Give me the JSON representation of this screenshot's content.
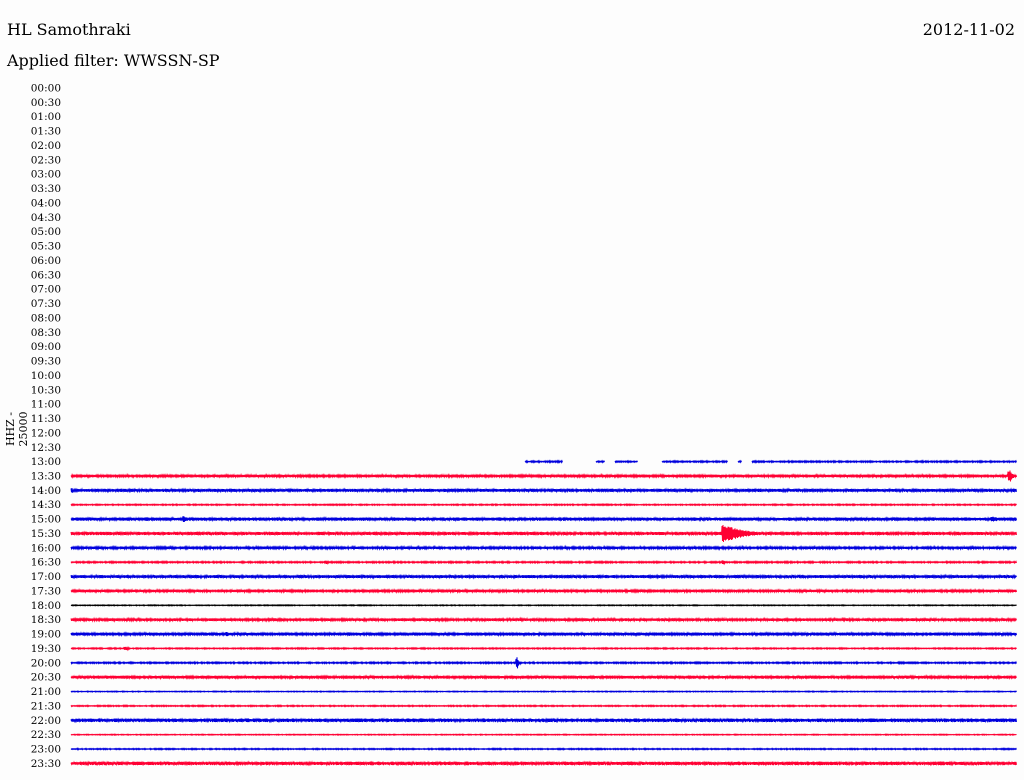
{
  "header": {
    "station": "HL Samothraki",
    "date": "2012-11-02",
    "filter": "Applied filter: WWSSN-SP",
    "channel": "HHZ - 25000"
  },
  "colors": {
    "red": "#ff0033",
    "blue": "#0000dd",
    "black": "#000000"
  },
  "chart_data": {
    "type": "line",
    "title": "HL Samothraki",
    "ylabel": "HHZ - 25000",
    "ytick_labels": [
      "00:00",
      "00:30",
      "01:00",
      "01:30",
      "02:00",
      "02:30",
      "03:00",
      "03:30",
      "04:00",
      "04:30",
      "05:00",
      "05:30",
      "06:00",
      "06:30",
      "07:00",
      "07:30",
      "08:00",
      "08:30",
      "09:00",
      "09:30",
      "10:00",
      "10:30",
      "11:00",
      "11:30",
      "12:00",
      "12:30",
      "13:00",
      "13:30",
      "14:00",
      "14:30",
      "15:00",
      "15:30",
      "16:00",
      "16:30",
      "17:00",
      "17:30",
      "18:00",
      "18:30",
      "19:00",
      "19:30",
      "20:00",
      "20:30",
      "21:00",
      "21:30",
      "22:00",
      "22:30",
      "23:00",
      "23:30"
    ],
    "x_range_minutes": [
      0,
      30
    ],
    "traces": [
      {
        "label": "13:00",
        "color": "blue",
        "start": 0.48,
        "noise": 0.5,
        "gaps": [
          [
            0.52,
            0.555
          ],
          [
            0.565,
            0.575
          ],
          [
            0.6,
            0.625
          ],
          [
            0.695,
            0.705
          ],
          [
            0.71,
            0.72
          ]
        ],
        "events": []
      },
      {
        "label": "13:30",
        "color": "red",
        "start": 0,
        "noise": 0.9,
        "gaps": [],
        "events": [
          {
            "x": 0.993,
            "amp": 7,
            "width": 0.007
          }
        ]
      },
      {
        "label": "14:00",
        "color": "blue",
        "start": 0,
        "noise": 1.0,
        "gaps": [],
        "events": [
          {
            "x": 0.001,
            "amp": 3,
            "width": 0.002
          }
        ]
      },
      {
        "label": "14:30",
        "color": "red",
        "start": 0,
        "noise": 0.4,
        "gaps": [],
        "events": []
      },
      {
        "label": "15:00",
        "color": "blue",
        "start": 0,
        "noise": 1.1,
        "gaps": [],
        "events": [
          {
            "x": 0.12,
            "amp": 3,
            "width": 0.01
          },
          {
            "x": 0.975,
            "amp": 3,
            "width": 0.02
          }
        ]
      },
      {
        "label": "15:30",
        "color": "red",
        "start": 0,
        "noise": 1.1,
        "gaps": [],
        "events": [
          {
            "x": 0.69,
            "amp": 10,
            "width": 0.045
          }
        ]
      },
      {
        "label": "16:00",
        "color": "blue",
        "start": 0,
        "noise": 0.8,
        "gaps": [],
        "events": []
      },
      {
        "label": "16:30",
        "color": "red",
        "start": 0,
        "noise": 0.5,
        "gaps": [],
        "events": [
          {
            "x": 0.27,
            "amp": 2,
            "width": 0.005
          },
          {
            "x": 0.69,
            "amp": 2,
            "width": 0.005
          }
        ]
      },
      {
        "label": "17:00",
        "color": "blue",
        "start": 0,
        "noise": 1.0,
        "gaps": [],
        "events": []
      },
      {
        "label": "17:30",
        "color": "red",
        "start": 0,
        "noise": 0.9,
        "gaps": [],
        "events": []
      },
      {
        "label": "18:00",
        "color": "black",
        "start": 0,
        "noise": 0.3,
        "gaps": [],
        "events": []
      },
      {
        "label": "18:30",
        "color": "red",
        "start": 0,
        "noise": 0.9,
        "gaps": [],
        "events": []
      },
      {
        "label": "19:00",
        "color": "blue",
        "start": 0,
        "noise": 1.0,
        "gaps": [],
        "events": [
          {
            "x": 0.165,
            "amp": 3,
            "width": 0.004
          },
          {
            "x": 0.295,
            "amp": 2,
            "width": 0.003
          }
        ]
      },
      {
        "label": "19:30",
        "color": "red",
        "start": 0,
        "noise": 0.4,
        "gaps": [],
        "events": [
          {
            "x": 0.058,
            "amp": 2,
            "width": 0.006
          }
        ]
      },
      {
        "label": "20:00",
        "color": "blue",
        "start": 0,
        "noise": 0.5,
        "gaps": [],
        "events": [
          {
            "x": 0.472,
            "amp": 6,
            "width": 0.004
          }
        ]
      },
      {
        "label": "20:30",
        "color": "red",
        "start": 0,
        "noise": 1.0,
        "gaps": [],
        "events": []
      },
      {
        "label": "21:00",
        "color": "blue",
        "start": 0,
        "noise": 0.3,
        "gaps": [],
        "events": []
      },
      {
        "label": "21:30",
        "color": "red",
        "start": 0,
        "noise": 0.4,
        "gaps": [],
        "events": []
      },
      {
        "label": "22:00",
        "color": "blue",
        "start": 0,
        "noise": 1.2,
        "gaps": [],
        "events": []
      },
      {
        "label": "22:30",
        "color": "red",
        "start": 0,
        "noise": 0.3,
        "gaps": [],
        "events": []
      },
      {
        "label": "23:00",
        "color": "blue",
        "start": 0,
        "noise": 0.4,
        "gaps": [],
        "events": []
      },
      {
        "label": "23:30",
        "color": "red",
        "start": 0,
        "noise": 1.2,
        "gaps": [],
        "events": []
      }
    ]
  }
}
